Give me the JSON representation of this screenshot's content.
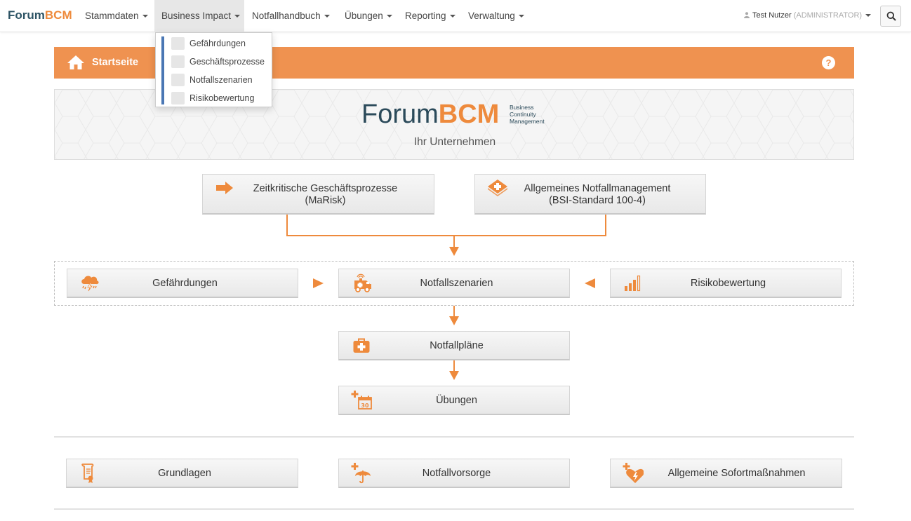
{
  "navbar": {
    "brand_part1": "Forum",
    "brand_part2": "BCM",
    "menu": [
      {
        "label": "Stammdaten"
      },
      {
        "label": "Business Impact"
      },
      {
        "label": "Notfallhandbuch"
      },
      {
        "label": "Übungen"
      },
      {
        "label": "Reporting"
      },
      {
        "label": "Verwaltung"
      }
    ],
    "user_name": "Test Nutzer",
    "user_role": "(ADMINISTRATOR)"
  },
  "dropdown": {
    "items": [
      {
        "label": "Gefährdungen"
      },
      {
        "label": "Geschäftsprozesse"
      },
      {
        "label": "Notfallszenarien"
      },
      {
        "label": "Risikobewertung"
      }
    ]
  },
  "page": {
    "title": "Startseite",
    "help": "?"
  },
  "banner": {
    "logo_part1": "Forum",
    "logo_part2": "BCM",
    "logo_sub1": "Business",
    "logo_sub2": "Continuity",
    "logo_sub3": "Management",
    "company": "Ihr Unternehmen"
  },
  "tiles": {
    "zeitkritisch_l1": "Zeitkritische Geschäftsprozesse",
    "zeitkritisch_l2": "(MaRisk)",
    "allgemein_l1": "Allgemeines Notfallmanagement",
    "allgemein_l2": "(BSI-Standard 100-4)",
    "gefaehrdungen": "Gefährdungen",
    "notfallszenarien": "Notfallszenarien",
    "risikobewertung": "Risikobewertung",
    "notfallplaene": "Notfallpläne",
    "uebungen": "Übungen",
    "grundlagen": "Grundlagen",
    "notfallvorsorge": "Notfallvorsorge",
    "sofortmassnahmen": "Allgemeine Sofortmaßnahmen"
  },
  "colors": {
    "accent": "#ee8a3c",
    "header": "#ef9250",
    "brand_dark": "#2c5364",
    "dropdown_bar": "#4a77b4"
  },
  "icons": {
    "home": "home-icon",
    "arrow": "arrow-right-icon",
    "kit": "first-aid-kit-icon",
    "storm": "storm-cloud-icon",
    "ambulance": "ambulance-icon",
    "bars": "signal-bars-icon",
    "calendar": "calendar-icon",
    "document": "document-icon",
    "umbrella": "umbrella-icon",
    "heart": "heart-icon"
  }
}
